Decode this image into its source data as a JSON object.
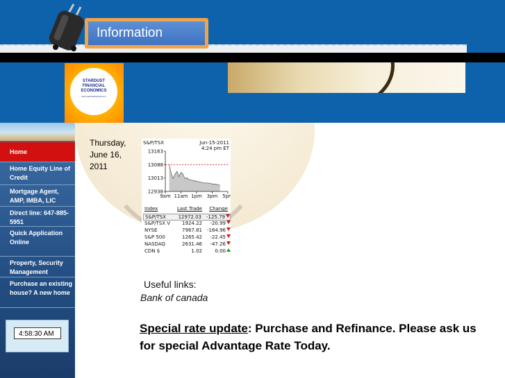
{
  "header": {
    "banner_label": "Information",
    "logo": {
      "name": "STARDUST FINANCIAL ECONOMICS",
      "sub": "www.stardustfinancial.com"
    }
  },
  "sidebar": {
    "items": [
      {
        "label": "Home",
        "active": true
      },
      {
        "label": "Home Equity Line of Credit"
      },
      {
        "label": "Mortgage Agent, AMP, IMBA, LIC"
      },
      {
        "label": "Direct line: 647-885-5951"
      },
      {
        "label": "Quick Application Online"
      },
      {
        "label": "Property, Security Management"
      },
      {
        "label": "Purchase an existing house? A new home"
      }
    ],
    "clock_value": "4:58:30 AM"
  },
  "main": {
    "date": "Thursday, June 16, 2011",
    "useful_links_label": "Useful links:",
    "bank_link": "Bank of canada",
    "special_title": "Special rate update",
    "special_body": ":   Purchase and Refinance. Please ask us for special Advantage Rate Today."
  },
  "ticker": {
    "symbol": "S&P/TSX",
    "date": "Jun-15-2011",
    "time": "4:24 pm  ET",
    "chart_data": {
      "type": "line",
      "ylim": [
        12938,
        13163
      ],
      "y_ticks": [
        "13163",
        "13088",
        "13013",
        "12938"
      ],
      "x_ticks": [
        "9am",
        "11am",
        "1pm",
        "3pm",
        "5pm"
      ],
      "previous_close": 13088,
      "x": [
        9.5,
        9.75,
        10,
        10.25,
        10.5,
        10.75,
        11,
        11.25,
        11.5,
        11.75,
        12,
        12.5,
        13,
        13.5,
        14,
        14.5,
        15,
        15.5,
        16
      ],
      "values": [
        13088,
        13040,
        13010,
        13035,
        13050,
        13020,
        13045,
        13035,
        13010,
        13015,
        13005,
        13000,
        12995,
        12990,
        12985,
        12985,
        12980,
        12978,
        12972
      ]
    },
    "columns": [
      "Index",
      "Last Trade",
      "Change"
    ],
    "rows": [
      {
        "index": "S&P/TSX",
        "last": "12972.03",
        "change": "-125.79",
        "dir": "down"
      },
      {
        "index": "S&P/TSX V",
        "last": "1924.22",
        "change": "-20.99",
        "dir": "down"
      },
      {
        "index": "NYSE",
        "last": "7967.81",
        "change": "-164.96",
        "dir": "down"
      },
      {
        "index": "S&P 500",
        "last": "1265.42",
        "change": "-22.45",
        "dir": "down"
      },
      {
        "index": "NASDAQ",
        "last": "2631.46",
        "change": "-47.26",
        "dir": "down"
      },
      {
        "index": "CDN $",
        "last": "1.02",
        "change": "0.00",
        "dir": "up"
      }
    ]
  }
}
